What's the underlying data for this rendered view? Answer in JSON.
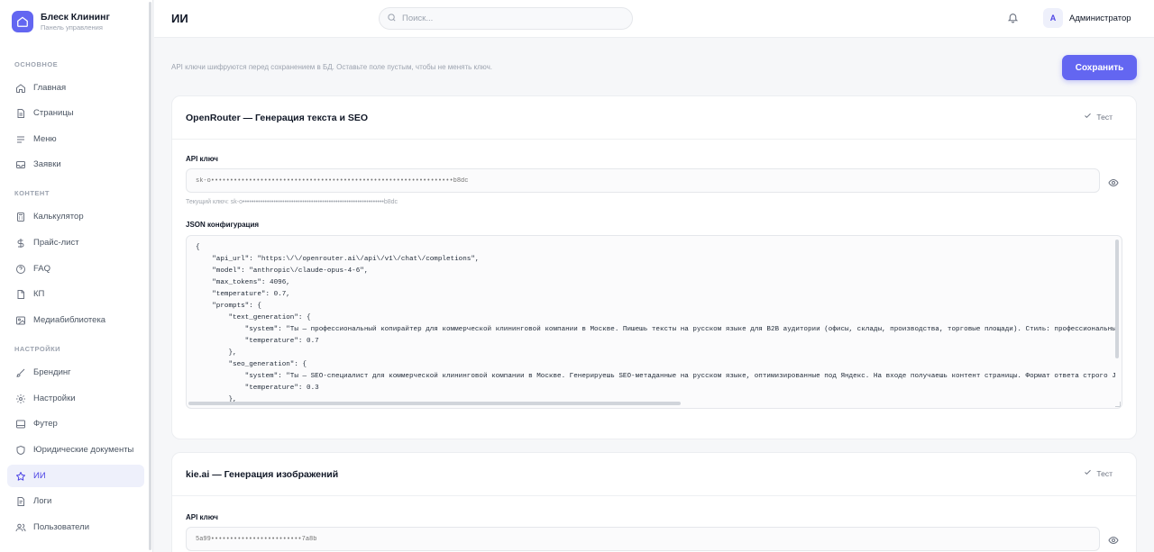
{
  "brand": {
    "title": "Блеск Клининг",
    "subtitle": "Панель управления"
  },
  "sidebar": {
    "sections": [
      {
        "label": "ОСНОВНОЕ"
      },
      {
        "label": "КОНТЕНТ"
      },
      {
        "label": "НАСТРОЙКИ"
      }
    ],
    "items": [
      {
        "label": "Главная",
        "icon": "home-icon"
      },
      {
        "label": "Страницы",
        "icon": "file-icon"
      },
      {
        "label": "Меню",
        "icon": "menu-icon"
      },
      {
        "label": "Заявки",
        "icon": "inbox-icon"
      },
      {
        "label": "Калькулятор",
        "icon": "calculator-icon"
      },
      {
        "label": "Прайс-лист",
        "icon": "dollar-icon"
      },
      {
        "label": "FAQ",
        "icon": "help-circle-icon"
      },
      {
        "label": "КП",
        "icon": "document-icon"
      },
      {
        "label": "Медиабиблиотека",
        "icon": "image-icon"
      },
      {
        "label": "Брендинг",
        "icon": "brush-icon"
      },
      {
        "label": "Настройки",
        "icon": "gear-icon"
      },
      {
        "label": "Футер",
        "icon": "layout-icon"
      },
      {
        "label": "Юридические документы",
        "icon": "shield-icon"
      },
      {
        "label": "ИИ",
        "icon": "star-icon",
        "active": true
      },
      {
        "label": "Логи",
        "icon": "log-file-icon"
      },
      {
        "label": "Пользователи",
        "icon": "users-icon"
      }
    ]
  },
  "header": {
    "title": "ИИ",
    "search_placeholder": "Поиск...",
    "user": {
      "initial": "A",
      "name": "Администратор"
    }
  },
  "main": {
    "hint": "API ключи шифруются перед сохранением в БД. Оставьте поле пустым, чтобы не менять ключ.",
    "save_label": "Сохранить",
    "cards": [
      {
        "title": "OpenRouter — Генерация текста и SEO",
        "test_label": "Тест",
        "key_label": "API ключ",
        "key_placeholder": "sk-o••••••••••••••••••••••••••••••••••••••••••••••••••••••••••••••••b8dc",
        "key_note": "Текущий ключ: sk-o••••••••••••••••••••••••••••••••••••••••••••••••••••••••••••••••b8dc",
        "json_label": "JSON конфигурация",
        "json_lines": [
          "{",
          "    \"api_url\": \"https:\\/\\/openrouter.ai\\/api\\/v1\\/chat\\/completions\",",
          "    \"model\": \"anthropic\\/claude-opus-4-6\",",
          "    \"max_tokens\": 4096,",
          "    \"temperature\": 0.7,",
          "    \"prompts\": {",
          "        \"text_generation\": {",
          "            \"system\": \"Ты — профессиональный копирайтер для коммерческой клининговой компании в Москве. Пишешь тексты на русском языке для B2B аудитории (офисы, склады, производства, торговые площади). Стиль: профессиональный, уб",
          "            \"temperature\": 0.7",
          "        },",
          "        \"seo_generation\": {",
          "            \"system\": \"Ты — SEO-специалист для коммерческой клининговой компании в Москве. Генерируешь SEO-метаданные на русском языке, оптимизированные под Яндекс. На входе получаешь контент страницы. Формат ответа строго JSON:\\",
          "            \"temperature\": 0.3",
          "        },"
        ]
      },
      {
        "title": "kie.ai — Генерация изображений",
        "test_label": "Тест",
        "key_label": "API ключ",
        "key_placeholder": "5a99••••••••••••••••••••••••7a8b"
      }
    ]
  },
  "colors": {
    "accent": "#6366f1",
    "active_bg": "#eef0fb",
    "text": "#111827",
    "muted": "#9ca3af"
  }
}
